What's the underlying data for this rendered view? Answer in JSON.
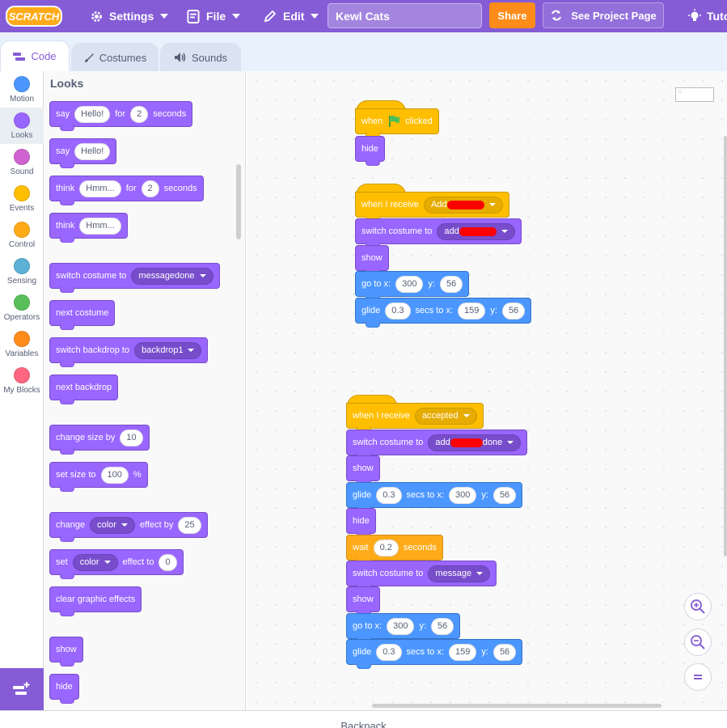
{
  "menubar": {
    "logo_text": "SCRATCH",
    "settings_label": "Settings",
    "file_label": "File",
    "edit_label": "Edit",
    "project_title": "Kewl Cats",
    "share_label": "Share",
    "see_project_label": "See Project Page",
    "tutorials_label": "Tuto"
  },
  "tabs": [
    {
      "label": "Code"
    },
    {
      "label": "Costumes"
    },
    {
      "label": "Sounds"
    }
  ],
  "categories": [
    {
      "label": "Motion",
      "color": "#4c97ff"
    },
    {
      "label": "Looks",
      "color": "#9966ff"
    },
    {
      "label": "Sound",
      "color": "#cf63cf"
    },
    {
      "label": "Events",
      "color": "#ffbf00"
    },
    {
      "label": "Control",
      "color": "#ffab19"
    },
    {
      "label": "Sensing",
      "color": "#5cb1d6"
    },
    {
      "label": "Operators",
      "color": "#59c059"
    },
    {
      "label": "Variables",
      "color": "#ff8c1a"
    },
    {
      "label": "My Blocks",
      "color": "#ff6680"
    }
  ],
  "palette": {
    "title": "Looks",
    "say_for_label": "say",
    "say_for_msg": "Hello!",
    "say_for_for": "for",
    "say_for_secs": "2",
    "say_for_seconds": "seconds",
    "say_label": "say",
    "say_msg": "Hello!",
    "think_for_label": "think",
    "think_for_msg": "Hmm...",
    "think_for_for": "for",
    "think_for_secs": "2",
    "think_for_seconds": "seconds",
    "think_label": "think",
    "think_msg": "Hmm...",
    "switch_costume_label": "switch costume to",
    "switch_costume_value": "messagedone",
    "next_costume": "next costume",
    "switch_backdrop_label": "switch backdrop to",
    "switch_backdrop_value": "backdrop1",
    "next_backdrop": "next backdrop",
    "change_size_label": "change size by",
    "change_size_value": "10",
    "set_size_label": "set size to",
    "set_size_value": "100",
    "set_size_unit": "%",
    "change_effect_label": "change",
    "change_effect_dd": "color",
    "change_effect_by": "effect by",
    "change_effect_value": "25",
    "set_effect_label": "set",
    "set_effect_dd": "color",
    "set_effect_to": "effect to",
    "set_effect_value": "0",
    "clear_effects": "clear graphic effects",
    "show": "show",
    "hide": "hide"
  },
  "script1": {
    "when_label": "when",
    "clicked_label": "clicked",
    "hide": "hide"
  },
  "script2": {
    "receive_label": "when I receive",
    "receive_value": "Add",
    "switch_label": "switch costume to",
    "switch_value": "add",
    "show": "show",
    "goto_label": "go to x:",
    "goto_x": "300",
    "goto_y_label": "y:",
    "goto_y": "56",
    "glide_label": "glide",
    "glide_secs": "0.3",
    "glide_secs_label": "secs to x:",
    "glide_x": "159",
    "glide_y_label": "y:",
    "glide_y": "56"
  },
  "script3": {
    "receive_label": "when I receive",
    "receive_value": "accepted",
    "switch1_label": "switch costume to",
    "switch1_value_pre": "add",
    "switch1_value_post": "done",
    "show1": "show",
    "glide1_label": "glide",
    "glide1_secs": "0.3",
    "glide1_secs_label": "secs to x:",
    "glide1_x": "300",
    "glide1_y_label": "y:",
    "glide1_y": "56",
    "hide": "hide",
    "wait_label": "wait",
    "wait_value": "0.2",
    "wait_seconds": "seconds",
    "switch2_label": "switch costume to",
    "switch2_value": "message",
    "show2": "show",
    "goto_label": "go to x:",
    "goto_x": "300",
    "goto_y_label": "y:",
    "goto_y": "56",
    "glide2_label": "glide",
    "glide2_secs": "0.3",
    "glide2_secs_label": "secs to x:",
    "glide2_x": "159",
    "glide2_y_label": "y:",
    "glide2_y": "56"
  },
  "backpack_label": "Backpack"
}
